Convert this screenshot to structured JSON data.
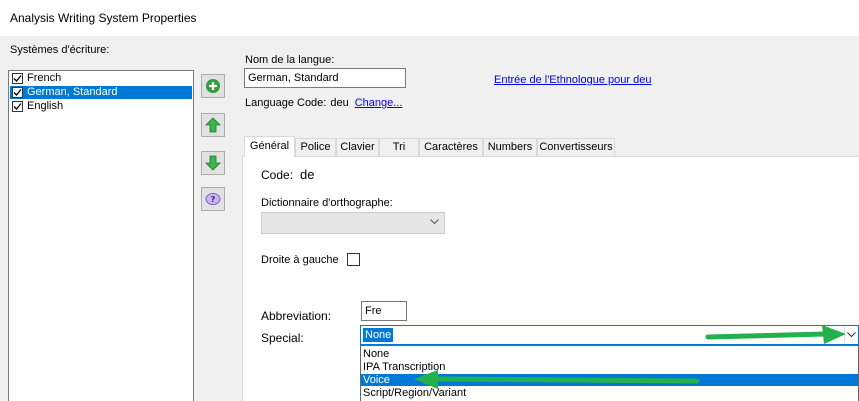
{
  "window": {
    "title": "Analysis Writing System Properties"
  },
  "writing_systems": {
    "label": "Systèmes d'écriture:",
    "items": [
      {
        "label": "French",
        "checked": true,
        "selected": false
      },
      {
        "label": "German, Standard",
        "checked": true,
        "selected": true
      },
      {
        "label": "English",
        "checked": true,
        "selected": false
      }
    ]
  },
  "side_buttons": {
    "add_icon": "plus-circle-icon",
    "up_icon": "arrow-up-icon",
    "down_icon": "arrow-down-icon",
    "help_icon": "question-icon"
  },
  "language": {
    "name_label": "Nom de la langue:",
    "name_value": "German, Standard",
    "ethnologue_link": "Entrée de l'Ethnologue pour deu",
    "code_label": "Language Code:",
    "code_value": "deu",
    "change_link": "Change..."
  },
  "tabs": [
    {
      "label": "Général",
      "active": true
    },
    {
      "label": "Police",
      "active": false
    },
    {
      "label": "Clavier",
      "active": false
    },
    {
      "label": "Tri",
      "active": false
    },
    {
      "label": "Caractères",
      "active": false
    },
    {
      "label": "Numbers",
      "active": false
    },
    {
      "label": "Convertisseurs",
      "active": false
    }
  ],
  "general": {
    "code_label": "Code:",
    "code_value": "de",
    "dictionary_label": "Dictionnaire d'orthographe:",
    "dictionary_value": "",
    "rtl_label": "Droite à gauche",
    "rtl_checked": false,
    "abbreviation_label": "Abbreviation:",
    "abbreviation_value": "Fre",
    "special_label": "Special:",
    "special_value": "None",
    "special_options": [
      {
        "label": "None",
        "highlighted": false
      },
      {
        "label": "IPA Transcription",
        "highlighted": false
      },
      {
        "label": "Voice",
        "highlighted": true
      },
      {
        "label": "Script/Region/Variant",
        "highlighted": false
      }
    ]
  },
  "annotations": {
    "arrow_color": "#22b14c"
  },
  "colors": {
    "selection": "#0078d7",
    "link": "#0000ee",
    "panel": "#f0f0f0"
  }
}
